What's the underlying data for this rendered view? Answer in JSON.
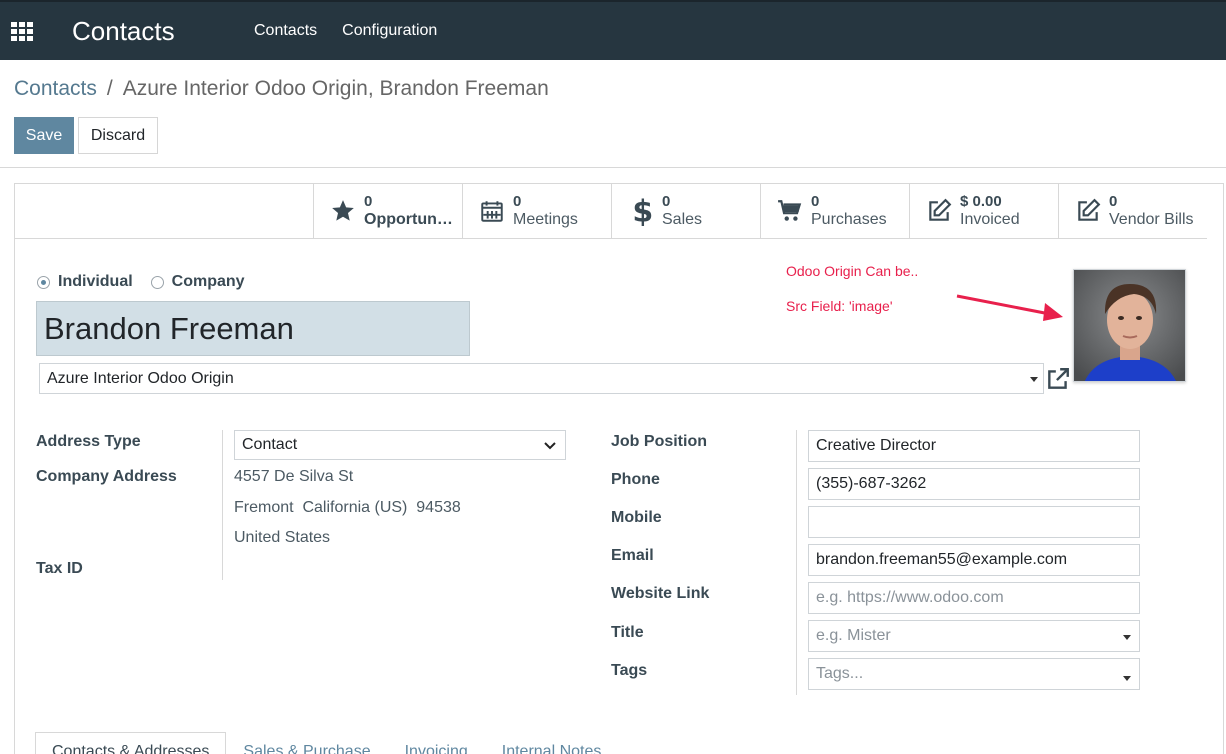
{
  "navbar": {
    "app_title": "Contacts",
    "menu": [
      "Contacts",
      "Configuration"
    ]
  },
  "breadcrumb": {
    "parent": "Contacts",
    "separator": "/",
    "current": "Azure Interior Odoo Origin, Brandon Freeman"
  },
  "toolbar": {
    "save_label": "Save",
    "discard_label": "Discard"
  },
  "stat_buttons": [
    {
      "icon": "star-icon",
      "value": "0",
      "label": "Opportunit..."
    },
    {
      "icon": "calendar-icon",
      "value": "0",
      "label": "Meetings"
    },
    {
      "icon": "dollar-icon",
      "value": "0",
      "label": "Sales"
    },
    {
      "icon": "cart-icon",
      "value": "0",
      "label": "Purchases"
    },
    {
      "icon": "edit-icon",
      "value": "$ 0.00",
      "label": "Invoiced"
    },
    {
      "icon": "edit-icon",
      "value": "0",
      "label": "Vendor Bills"
    }
  ],
  "company_type": {
    "options": [
      "Individual",
      "Company"
    ],
    "selected": "Individual"
  },
  "contact": {
    "name": "Brandon Freeman",
    "parent_company": "Azure Interior Odoo Origin"
  },
  "annotations": {
    "line1": "Odoo Origin Can be..",
    "line2": "Src Field: 'image'"
  },
  "left_group": {
    "address_type_label": "Address Type",
    "address_type_value": "Contact",
    "company_address_label": "Company Address",
    "street": "4557 De Silva St",
    "city_line": "Fremont  California (US)  94538",
    "country": "United States",
    "tax_id_label": "Tax ID"
  },
  "right_group": {
    "job_position_label": "Job Position",
    "job_position_value": "Creative Director",
    "phone_label": "Phone",
    "phone_value": "(355)-687-3262",
    "mobile_label": "Mobile",
    "mobile_value": "",
    "email_label": "Email",
    "email_value": "brandon.freeman55@example.com",
    "website_label": "Website Link",
    "website_placeholder": "e.g. https://www.odoo.com",
    "title_label": "Title",
    "title_placeholder": "e.g. Mister",
    "tags_label": "Tags",
    "tags_placeholder": "Tags..."
  },
  "tabs": [
    "Contacts & Addresses",
    "Sales & Purchase",
    "Invoicing",
    "Internal Notes"
  ],
  "colors": {
    "navbar": "#263640",
    "primary": "#5f87a0",
    "annotation": "#e8204c",
    "name_field_bg": "#d2dfe6"
  }
}
